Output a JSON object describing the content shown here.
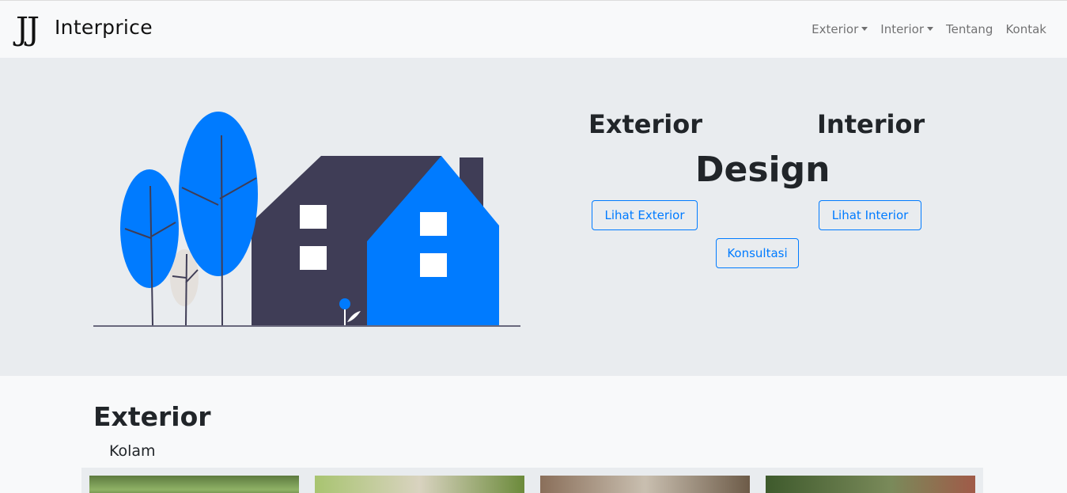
{
  "navbar": {
    "brand_logo": "JJ",
    "brand_name": "Interprice",
    "links": [
      {
        "label": "Exterior",
        "dropdown": true
      },
      {
        "label": "Interior",
        "dropdown": true
      },
      {
        "label": "Tentang",
        "dropdown": false
      },
      {
        "label": "Kontak",
        "dropdown": false
      }
    ]
  },
  "hero": {
    "title_exterior": "Exterior",
    "title_interior": "Interior",
    "title_design": "Design",
    "btn_exterior": "Lihat Exterior",
    "btn_interior": "Lihat Interior",
    "btn_konsultasi": "Konsultasi",
    "illustration": "house-with-trees-illustration"
  },
  "section": {
    "title": "Exterior",
    "subtitle": "Kolam",
    "thumbnails": [
      "garden-photo",
      "palm-photo",
      "pergola-photo",
      "patio-photo"
    ]
  },
  "colors": {
    "accent": "#007bff",
    "dark_house": "#3f3d56",
    "hero_bg": "#e9ecef",
    "navbar_bg": "#f8f9fa"
  }
}
